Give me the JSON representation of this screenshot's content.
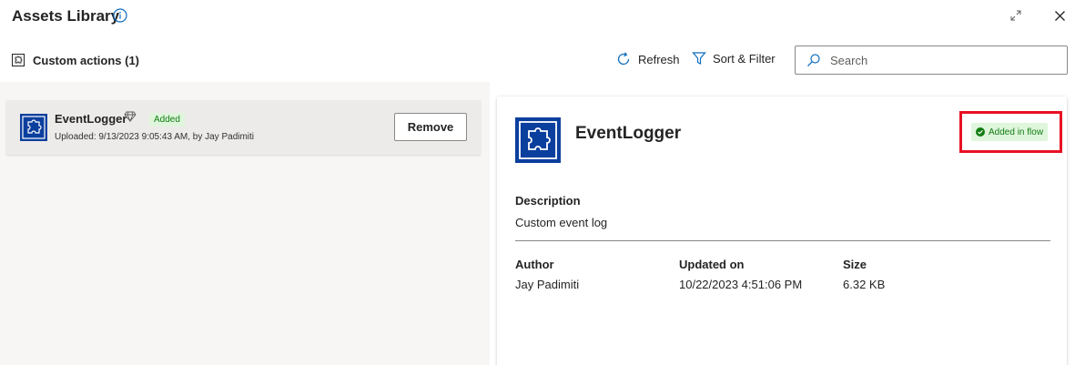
{
  "header": {
    "title": "Assets Library"
  },
  "toolbar": {
    "custom_actions_label": "Custom actions (1)",
    "refresh_label": "Refresh",
    "sort_filter_label": "Sort & Filter",
    "search_placeholder": "Search",
    "search_value": ""
  },
  "asset_list": {
    "items": [
      {
        "name": "EventLogger",
        "badge": "Added",
        "uploaded": "Uploaded: 9/13/2023 9:05:43 AM, by Jay Padimiti",
        "remove_label": "Remove"
      }
    ]
  },
  "details": {
    "name": "EventLogger",
    "status_badge": "Added in flow",
    "description_label": "Description",
    "description_value": "Custom event log",
    "author_label": "Author",
    "author_value": "Jay Padimiti",
    "updated_label": "Updated on",
    "updated_value": "10/22/2023 4:51:06 PM",
    "size_label": "Size",
    "size_value": "6.32 KB"
  },
  "colors": {
    "accent": "#0f6cbd",
    "asset_icon": "#0b3f9e",
    "success_bg": "#dff6dd",
    "success_text": "#107c10",
    "highlight": "#e81123"
  },
  "icons": {
    "info": "info-icon",
    "expand": "expand-icon",
    "close": "close-icon",
    "refresh": "refresh-icon",
    "filter": "filter-icon",
    "search": "search-icon",
    "puzzle": "puzzle-icon",
    "premium": "diamond-icon",
    "check": "check-circle-icon"
  }
}
